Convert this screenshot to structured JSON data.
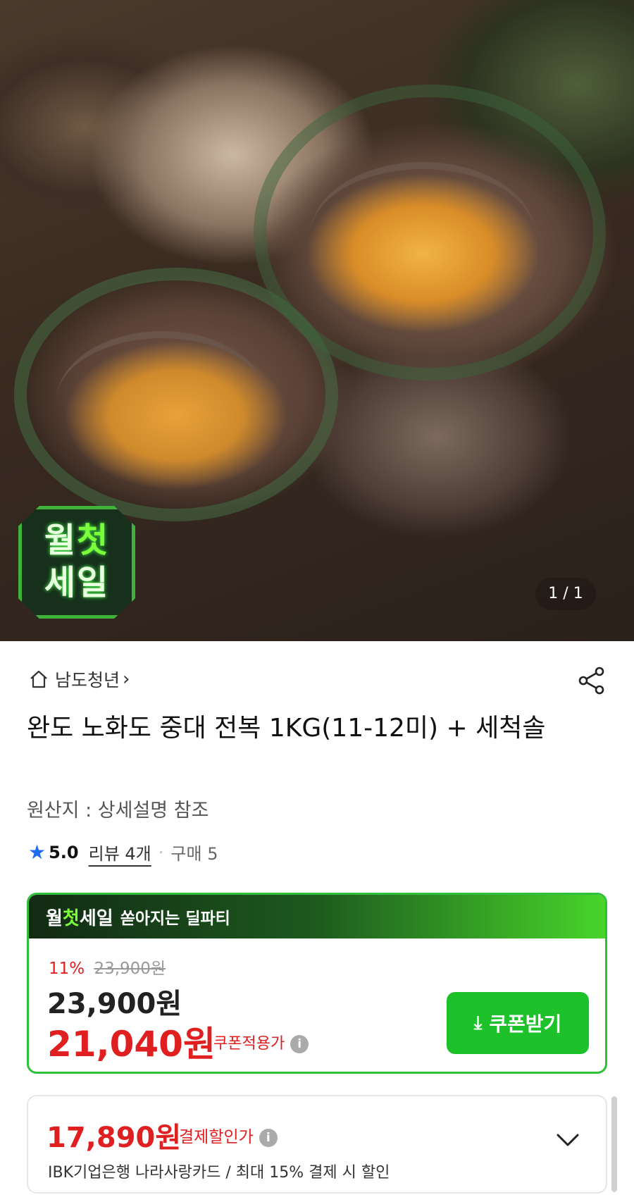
{
  "hero": {
    "badge_line1_a": "월",
    "badge_line1_b": "첫",
    "badge_line2": "세일",
    "page_indicator": "1 / 1"
  },
  "seller": {
    "name": "남도청년",
    "chevron": "›"
  },
  "product": {
    "title": "완도 노화도 중대 전복 1KG(11-12미) + 세척솔",
    "origin": "원산지 : 상세설명 참조",
    "rating": "5.0",
    "review": "리뷰 4개",
    "separator": "·",
    "purchases": "구매 5"
  },
  "deal": {
    "head_word1": "월",
    "head_word2": "첫",
    "head_word3": "세일",
    "head_sub": "쏟아지는 딜파티",
    "discount_percent": "11%",
    "old_price": "23,900원",
    "price": "23,900원",
    "final_price": "21,040원",
    "coupon_label": "쿠폰적용가",
    "coupon_button": "쿠폰받기"
  },
  "payment": {
    "price": "17,890원",
    "label": "결제할인가",
    "desc": "IBK기업은행 나라사랑카드 / 최대 15% 결제 시 할인"
  },
  "colors": {
    "accent_red": "#e02020",
    "accent_green": "#1dc22b",
    "star_blue": "#1e6df0"
  },
  "icons": [
    "home-icon",
    "share-icon",
    "star-icon",
    "info-icon",
    "download-icon",
    "chevron-down-icon"
  ]
}
